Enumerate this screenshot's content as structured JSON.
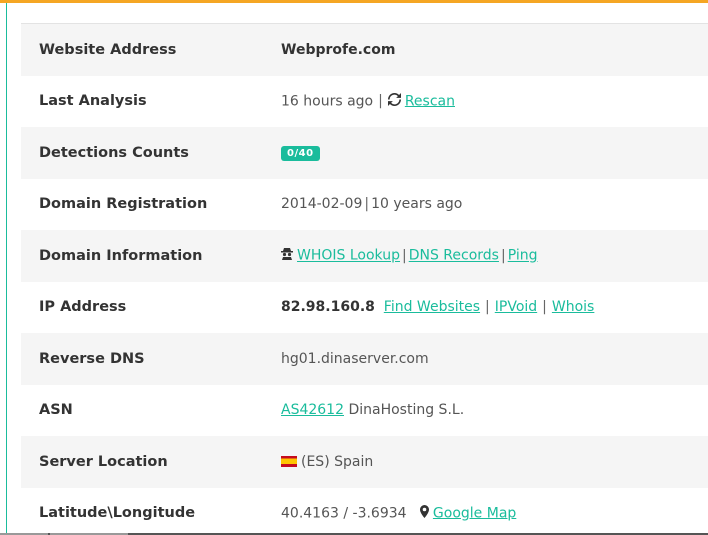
{
  "colors": {
    "accent": "#1abc9c",
    "topbar": "#f5a623"
  },
  "rows": {
    "website": {
      "label": "Website Address",
      "value": "Webprofe.com"
    },
    "last_analysis": {
      "label": "Last Analysis",
      "time": "16 hours ago",
      "sep": "|",
      "rescan": "Rescan",
      "icon": "refresh-icon"
    },
    "detections": {
      "label": "Detections Counts",
      "badge": "0/40"
    },
    "domain_reg": {
      "label": "Domain Registration",
      "date": "2014-02-09",
      "sep": "|",
      "age": "10 years ago"
    },
    "domain_info": {
      "label": "Domain Information",
      "icon": "spy-icon",
      "whois": "WHOIS Lookup",
      "sep": "|",
      "dns": "DNS Records",
      "ping": "Ping"
    },
    "ip": {
      "label": "IP Address",
      "value": "82.98.160.8",
      "find": "Find Websites",
      "sep": "|",
      "ipvoid": "IPVoid",
      "whois": "Whois"
    },
    "reverse_dns": {
      "label": "Reverse DNS",
      "value": "hg01.dinaserver.com"
    },
    "asn": {
      "label": "ASN",
      "asn": "AS42612",
      "org": "DinaHosting S.L."
    },
    "location": {
      "label": "Server Location",
      "flag": "spain-flag-icon",
      "value": "(ES) Spain"
    },
    "latlong": {
      "label": "Latitude\\Longitude",
      "value": "40.4163 / -3.6934",
      "icon": "map-marker-icon",
      "map": "Google Map"
    }
  }
}
